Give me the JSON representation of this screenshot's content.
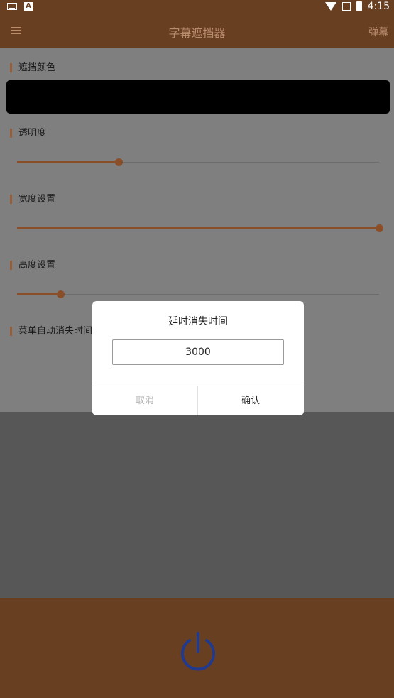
{
  "status_bar": {
    "time": "4:15",
    "icons": [
      "keyboard-icon",
      "a-icon",
      "wifi-icon",
      "signal-icon",
      "battery-icon"
    ]
  },
  "app_bar": {
    "title": "字幕遮挡器",
    "right_action": "弹幕",
    "menu_icon": "hamburger-icon"
  },
  "settings": {
    "color_label": "遮挡颜色",
    "color_value": "#000000",
    "transparency_label": "透明度",
    "transparency_value": 0.28,
    "width_label": "宽度设置",
    "width_value": 1.0,
    "height_label": "高度设置",
    "height_value": 0.12,
    "auto_hide_label": "菜单自动消失时间"
  },
  "dialog": {
    "title": "延时消失时间",
    "input_value": "3000",
    "cancel_label": "取消",
    "confirm_label": "确认"
  },
  "bottom": {
    "power_icon": "power-icon"
  },
  "colors": {
    "brand_brown": "#693f22",
    "slider_accent": "#8a4e28",
    "power_blue": "#1f3a8f"
  }
}
